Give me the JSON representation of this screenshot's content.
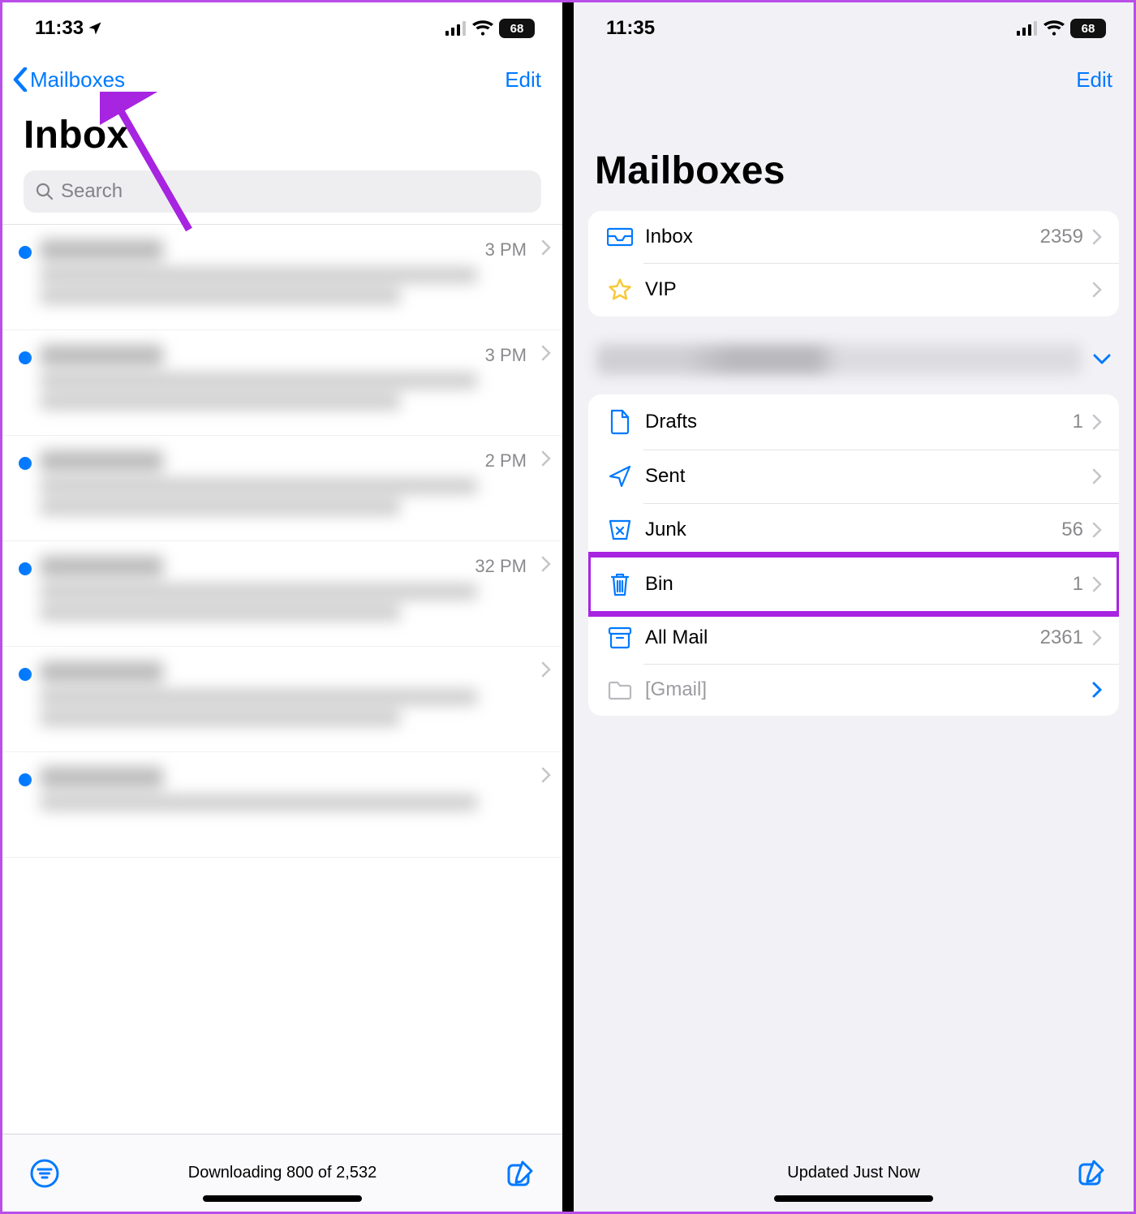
{
  "colors": {
    "accent": "#0079ff",
    "annotation": "#a724e0",
    "muted": "#8a8a8e",
    "star": "#f7c938"
  },
  "left": {
    "status": {
      "time": "11:33",
      "battery": "68"
    },
    "nav_back": "Mailboxes",
    "nav_edit": "Edit",
    "title": "Inbox",
    "search_placeholder": "Search",
    "messages": [
      {
        "time": "3 PM"
      },
      {
        "time": "3 PM"
      },
      {
        "time": "2 PM"
      },
      {
        "time": "32 PM"
      },
      {
        "time": ""
      },
      {
        "time": ""
      }
    ],
    "toolbar_status": "Downloading 800 of 2,532"
  },
  "right": {
    "status": {
      "time": "11:35",
      "battery": "68"
    },
    "nav_edit": "Edit",
    "title": "Mailboxes",
    "top_group": [
      {
        "icon": "inbox-icon",
        "label": "Inbox",
        "count": "2359"
      },
      {
        "icon": "star-icon",
        "label": "VIP",
        "count": ""
      }
    ],
    "account_group": [
      {
        "icon": "doc-icon",
        "label": "Drafts",
        "count": "1"
      },
      {
        "icon": "send-icon",
        "label": "Sent",
        "count": ""
      },
      {
        "icon": "junk-icon",
        "label": "Junk",
        "count": "56"
      },
      {
        "icon": "trash-icon",
        "label": "Bin",
        "count": "1"
      },
      {
        "icon": "archive-icon",
        "label": "All Mail",
        "count": "2361"
      },
      {
        "icon": "folder-icon",
        "label": "[Gmail]",
        "count": ""
      }
    ],
    "toolbar_status": "Updated Just Now"
  }
}
